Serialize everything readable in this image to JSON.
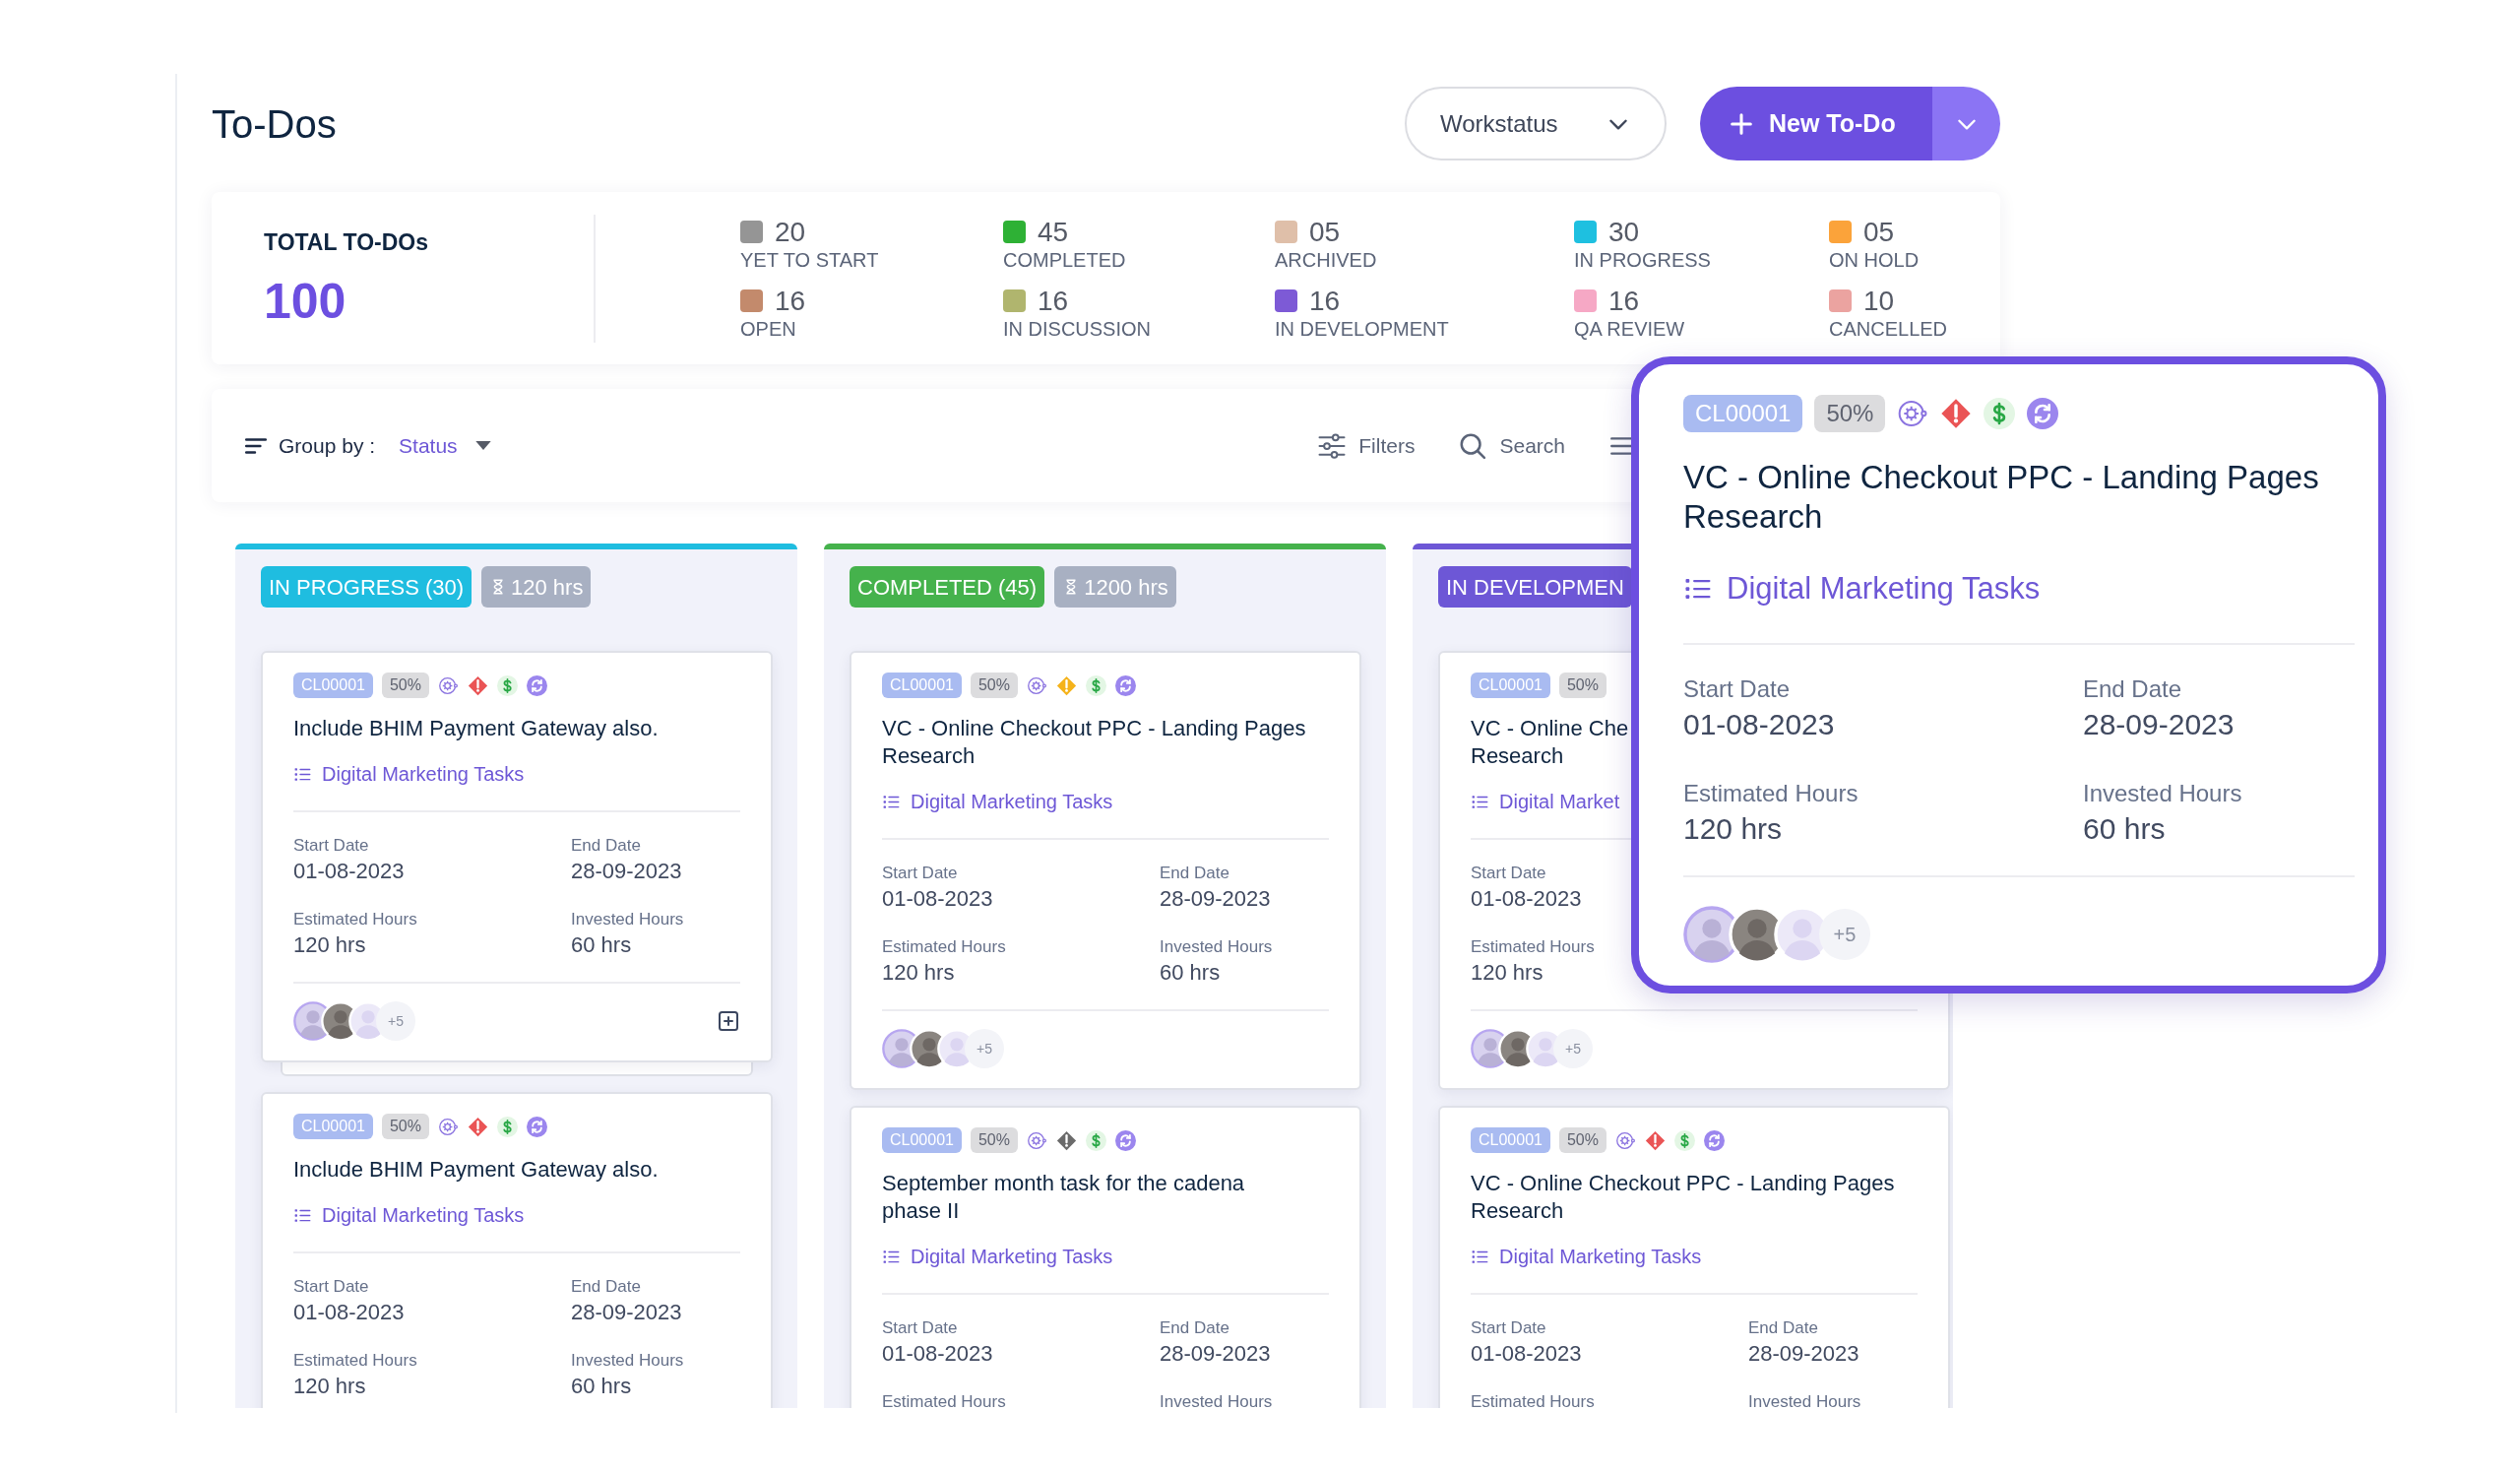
{
  "page": {
    "title": "To-Dos"
  },
  "workstatus_dropdown": {
    "label": "Workstatus"
  },
  "new_button": {
    "label": "New To-Do"
  },
  "summary": {
    "title": "TOTAL TO-DOs",
    "total": "100",
    "statuses": [
      {
        "count": "20",
        "label": "YET TO START",
        "color": "#959595"
      },
      {
        "count": "45",
        "label": "COMPLETED",
        "color": "#2eb135"
      },
      {
        "count": "05",
        "label": "ARCHIVED",
        "color": "#dfbfa9"
      },
      {
        "count": "30",
        "label": "IN PROGRESS",
        "color": "#1ec0e0"
      },
      {
        "count": "05",
        "label": "ON HOLD",
        "color": "#fba33a"
      },
      {
        "count": "16",
        "label": "OPEN",
        "color": "#c38a6c"
      },
      {
        "count": "16",
        "label": "IN DISCUSSION",
        "color": "#b0b56e"
      },
      {
        "count": "16",
        "label": "IN DEVELOPMENT",
        "color": "#7d5ad6"
      },
      {
        "count": "16",
        "label": "QA REVIEW",
        "color": "#f6a8c5"
      },
      {
        "count": "10",
        "label": "CANCELLED",
        "color": "#eba3a0"
      }
    ]
  },
  "toolbar": {
    "group_by_label": "Group by :",
    "group_by_value": "Status",
    "actions": [
      {
        "kind": "filters",
        "label": "Filters"
      },
      {
        "kind": "search",
        "label": "Search"
      },
      {
        "kind": "view"
      }
    ]
  },
  "columns": [
    {
      "title": "IN PROGRESS (30)",
      "hours": "120 hrs",
      "color": "#1fbde0",
      "cards": [
        {
          "id": "CL00001",
          "progress": "50%",
          "alert": {
            "color": "#ea5455"
          },
          "title": [
            "Include BHIM Payment Gateway also."
          ],
          "category": "Digital Marketing Tasks",
          "rows": [
            [
              {
                "label": "Start Date",
                "value": "01-08-2023"
              },
              {
                "label": "End Date",
                "value": "28-09-2023"
              }
            ],
            [
              {
                "label": "Estimated Hours",
                "value": "120 hrs"
              },
              {
                "label": "Invested Hours",
                "value": "60 hrs"
              }
            ]
          ],
          "more": "+5",
          "add_button": true,
          "stacked": true
        },
        {
          "id": "CL00001",
          "progress": "50%",
          "alert": {
            "color": "#ea5455"
          },
          "title": [
            "Include BHIM Payment Gateway also."
          ],
          "category": "Digital Marketing Tasks",
          "rows": [
            [
              {
                "label": "Start Date",
                "value": "01-08-2023"
              },
              {
                "label": "End Date",
                "value": "28-09-2023"
              }
            ],
            [
              {
                "label": "Estimated Hours",
                "value": "120 hrs"
              },
              {
                "label": "Invested Hours",
                "value": "60 hrs"
              }
            ]
          ]
        }
      ]
    },
    {
      "title": "COMPLETED (45)",
      "hours": "1200 hrs",
      "color": "#45b24c",
      "cards": [
        {
          "id": "CL00001",
          "progress": "50%",
          "alert": {
            "color": "#f5b31b"
          },
          "title": [
            "VC - Online Checkout PPC - Landing Pages",
            "Research"
          ],
          "category": "Digital Marketing Tasks",
          "rows": [
            [
              {
                "label": "Start Date",
                "value": "01-08-2023"
              },
              {
                "label": "End Date",
                "value": "28-09-2023"
              }
            ],
            [
              {
                "label": "Estimated Hours",
                "value": "120 hrs"
              },
              {
                "label": "Invested Hours",
                "value": "60 hrs"
              }
            ]
          ],
          "more": "+5"
        },
        {
          "id": "CL00001",
          "progress": "50%",
          "alert": {
            "color": "#6b6b6b"
          },
          "title": [
            "September month task for the cadena",
            "phase II"
          ],
          "category": "Digital Marketing Tasks",
          "rows": [
            [
              {
                "label": "Start Date",
                "value": "01-08-2023"
              },
              {
                "label": "End Date",
                "value": "28-09-2023"
              }
            ],
            [
              {
                "label": "Estimated Hours"
              },
              {
                "label": "Invested Hours"
              }
            ]
          ]
        }
      ]
    },
    {
      "title": "IN DEVELOPMEN",
      "color": "#6d57d6",
      "cards": [
        {
          "id": "CL00001",
          "progress": "50%",
          "title": [
            "VC - Online Che",
            "Research"
          ],
          "category": "Digital Market",
          "rows": [
            [
              {
                "label": "Start Date",
                "value": "01-08-2023"
              }
            ],
            [
              {
                "label": "Estimated Hours",
                "value": "120 hrs"
              }
            ]
          ],
          "more": "+5"
        },
        {
          "id": "CL00001",
          "progress": "50%",
          "alert": {
            "color": "#ea5455"
          },
          "title": [
            "VC - Online Checkout PPC - Landing Pages",
            "Research"
          ],
          "category": "Digital Marketing Tasks",
          "rows": [
            [
              {
                "label": "Start Date",
                "value": "01-08-2023"
              },
              {
                "label": "End Date",
                "value": "28-09-2023"
              }
            ],
            [
              {
                "label": "Estimated Hours"
              },
              {
                "label": "Invested Hours"
              }
            ]
          ]
        }
      ]
    }
  ],
  "popup_card": {
    "id": "CL00001",
    "progress": "50%",
    "alert": {
      "color": "#ea5455"
    },
    "title": [
      "VC - Online Checkout PPC - Landing Pages",
      "Research"
    ],
    "category": "Digital Marketing Tasks",
    "rows": [
      [
        {
          "label": "Start Date",
          "value": "01-08-2023"
        },
        {
          "label": "End Date",
          "value": "28-09-2023"
        }
      ],
      [
        {
          "label": "Estimated Hours",
          "value": "120 hrs"
        },
        {
          "label": "Invested Hours",
          "value": "60 hrs"
        }
      ]
    ],
    "more": "+5"
  }
}
